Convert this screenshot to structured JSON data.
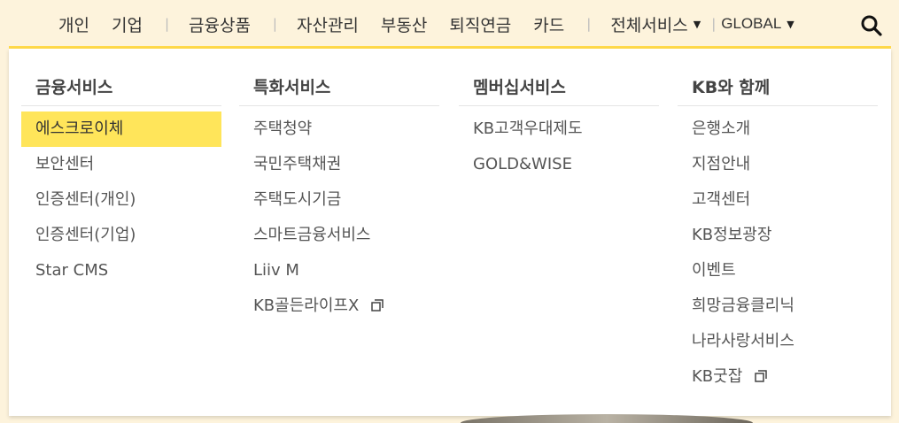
{
  "topnav": {
    "personal": "개인",
    "business": "기업",
    "products": "금융상품",
    "asset": "자산관리",
    "realestate": "부동산",
    "pension": "퇴직연금",
    "card": "카드",
    "all_services": "전체서비스",
    "global": "GLOBAL",
    "separator": "|"
  },
  "columns": {
    "financial": {
      "title": "금융서비스",
      "items": [
        "에스크로이체",
        "보안센터",
        "인증센터(개인)",
        "인증센터(기업)",
        "Star CMS"
      ]
    },
    "special": {
      "title": "특화서비스",
      "items": [
        "주택청약",
        "국민주택채권",
        "주택도시기금",
        "스마트금융서비스",
        "Liiv M",
        "KB골든라이프X"
      ]
    },
    "membership": {
      "title": "멤버십서비스",
      "items": [
        "KB고객우대제도",
        "GOLD&WISE"
      ]
    },
    "together": {
      "title": "KB와 함께",
      "items": [
        "은행소개",
        "지점안내",
        "고객센터",
        "KB정보광장",
        "이벤트",
        "희망금융클리닉",
        "나라사랑서비스",
        "KB굿잡"
      ]
    }
  },
  "colors": {
    "accent": "#ffe55a",
    "gold_line": "#ffd94a",
    "background": "#fdf3dc"
  },
  "icons": {
    "search": "search-icon",
    "new_window": "new-window-icon",
    "caret": "caret-down-icon"
  }
}
